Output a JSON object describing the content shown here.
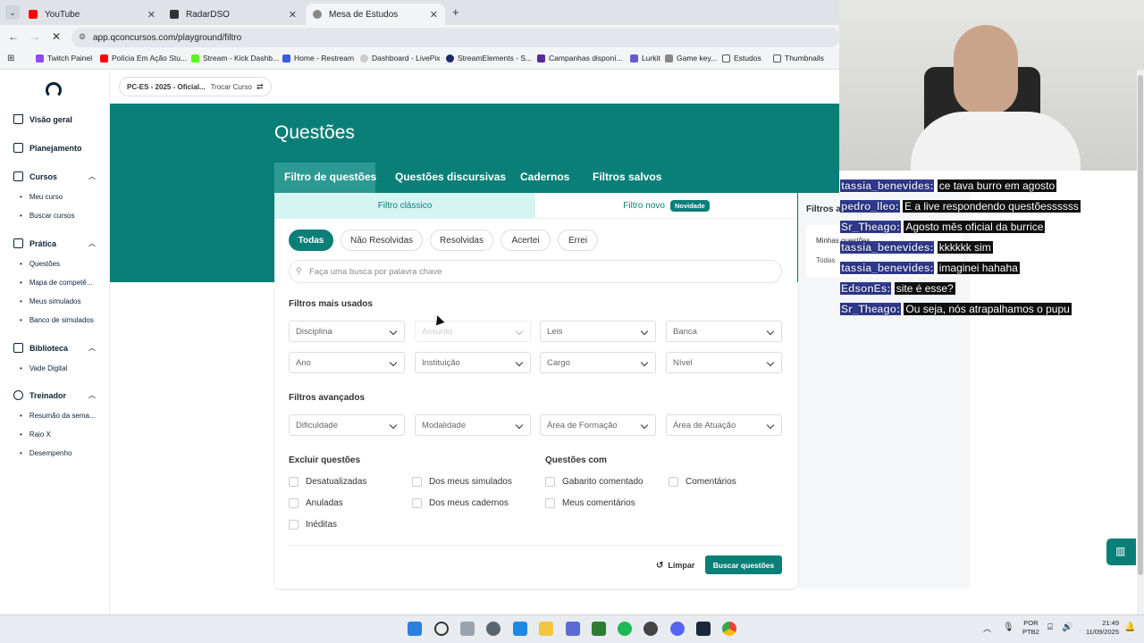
{
  "browser": {
    "tabs": [
      {
        "title": "YouTube",
        "color": "#ff0000"
      },
      {
        "title": "RadarDSO",
        "color": "#333333"
      },
      {
        "title": "Mesa de Estudos",
        "color": "#555555"
      }
    ],
    "url": "app.qconcursos.com/playground/filtro",
    "bookmarks": [
      "Twitch Painel",
      "Polícia Em Ação Stu...",
      "Stream - Kick Dashb...",
      "Home - Restream",
      "Dashboard - LivePix",
      "StreamElements - S...",
      "Campanhas disponí...",
      "Lurkit",
      "Game key...",
      "Estudos",
      "Thumbnails"
    ]
  },
  "course_selector": {
    "course": "PC-ES - 2025 - Oficial...",
    "change": "Trocar Curso"
  },
  "sidebar": {
    "visao_geral": "Visão geral",
    "planejamento": "Planejamento",
    "cursos": "Cursos",
    "cursos_items": [
      "Meu curso",
      "Buscar cursos"
    ],
    "pratica": "Prática",
    "pratica_items": [
      "Questões",
      "Mapa de competê...",
      "Meus simulados",
      "Banco de simulados"
    ],
    "biblioteca": "Biblioteca",
    "biblioteca_items": [
      "Vade Digital"
    ],
    "treinador": "Treinador",
    "treinador_items": [
      "Resumão da sema...",
      "Raio X",
      "Desempenho"
    ]
  },
  "page": {
    "title": "Questões",
    "main_tabs": [
      "Filtro de questões",
      "Questões discursivas",
      "Cadernos",
      "Filtros salvos"
    ],
    "sub_tabs": {
      "classic": "Filtro clássico",
      "new": "Filtro novo",
      "new_badge": "Novidade"
    },
    "status_pills": [
      "Todas",
      "Não Resolvidas",
      "Resolvidas",
      "Acertei",
      "Errei"
    ],
    "search_placeholder": "Faça uma busca por palavra chave",
    "most_used_title": "Filtros mais usados",
    "most_used": [
      "Disciplina",
      "Assunto",
      "Leis",
      "Banca",
      "Ano",
      "Instituição",
      "Cargo",
      "Nível"
    ],
    "advanced_title": "Filtros avançados",
    "advanced": [
      "Dificuldade",
      "Modalidade",
      "Área de Formação",
      "Área de Atuação"
    ],
    "exclude_title": "Excluir questões",
    "exclude": [
      "Desatualizadas",
      "Dos meus simulados",
      "Anuladas",
      "Dos meus cadernos",
      "Inéditas"
    ],
    "with_title": "Questões com",
    "with": [
      "Gabarito comentado",
      "Comentários",
      "Meus comentários"
    ],
    "clear": "Limpar",
    "search_button": "Buscar questões",
    "right_panel": {
      "title": "Filtros a",
      "label": "Minhas questões",
      "value": "Todas"
    }
  },
  "chat": [
    {
      "user": "tassia_benevides:",
      "msg": "ce tava burro em agosto"
    },
    {
      "user": "pedro_lleo:",
      "msg": "E a live respondendo questõessssss"
    },
    {
      "user": "Sr_Theago:",
      "msg": "Agosto mês oficial da burrice"
    },
    {
      "user": "tassia_benevides:",
      "msg": "kkkkkk sim"
    },
    {
      "user": "tassia_benevides:",
      "msg": "imaginei hahaha"
    },
    {
      "user": "EdsonEs:",
      "msg": "site é esse?"
    },
    {
      "user": "Sr_Theago:",
      "msg": "Ou seja, nós atrapalhamos o pupu"
    }
  ],
  "taskbar": {
    "lang": "POR",
    "layout": "PTB2",
    "time": "21:49",
    "date": "11/09/2025"
  }
}
